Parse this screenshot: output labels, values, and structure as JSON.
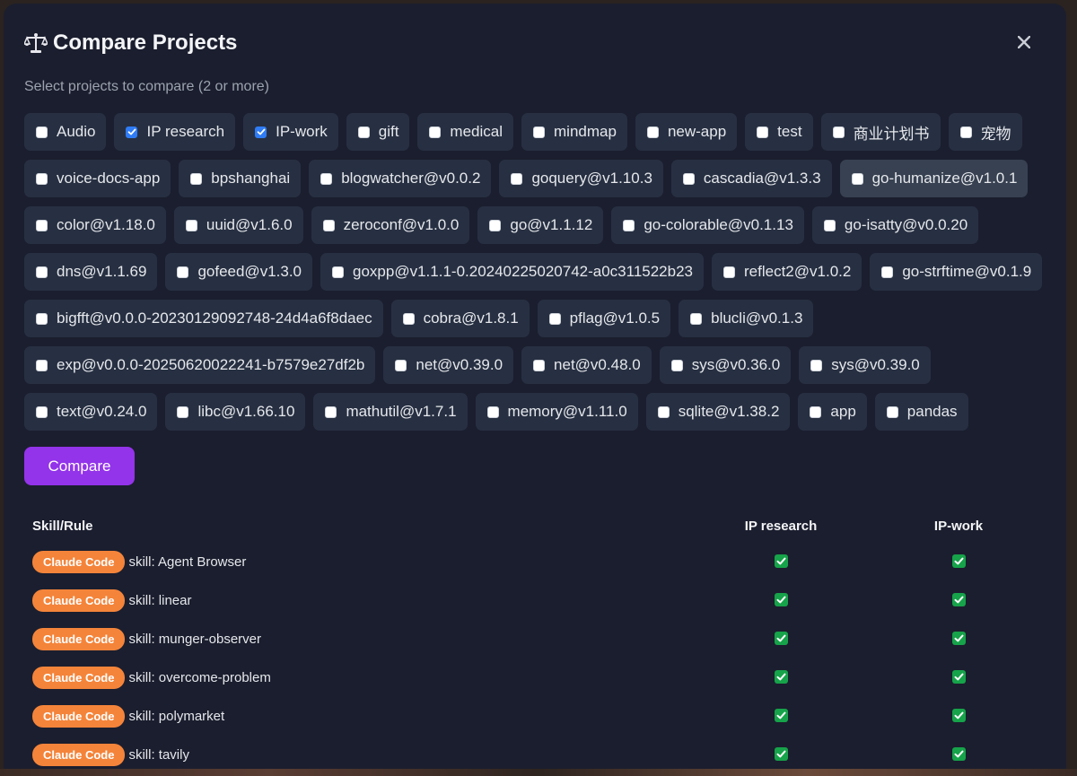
{
  "dialog": {
    "title": "Compare Projects",
    "title_icon": "scales-icon",
    "subtitle": "Select projects to compare (2 or more)",
    "close_icon": "close-icon",
    "compare_label": "Compare"
  },
  "projects": [
    {
      "label": "Audio",
      "checked": false
    },
    {
      "label": "IP research",
      "checked": true
    },
    {
      "label": "IP-work",
      "checked": true
    },
    {
      "label": "gift",
      "checked": false
    },
    {
      "label": "medical",
      "checked": false
    },
    {
      "label": "mindmap",
      "checked": false
    },
    {
      "label": "new-app",
      "checked": false
    },
    {
      "label": "test",
      "checked": false
    },
    {
      "label": "商业计划书",
      "checked": false
    },
    {
      "label": "宠物",
      "checked": false
    },
    {
      "label": "voice-docs-app",
      "checked": false
    },
    {
      "label": "bpshanghai",
      "checked": false
    },
    {
      "label": "blogwatcher@v0.0.2",
      "checked": false
    },
    {
      "label": "goquery@v1.10.3",
      "checked": false
    },
    {
      "label": "cascadia@v1.3.3",
      "checked": false
    },
    {
      "label": "go-humanize@v1.0.1",
      "checked": false,
      "hover": true
    },
    {
      "label": "color@v1.18.0",
      "checked": false
    },
    {
      "label": "uuid@v1.6.0",
      "checked": false
    },
    {
      "label": "zeroconf@v1.0.0",
      "checked": false
    },
    {
      "label": "go@v1.1.12",
      "checked": false
    },
    {
      "label": "go-colorable@v0.1.13",
      "checked": false
    },
    {
      "label": "go-isatty@v0.0.20",
      "checked": false
    },
    {
      "label": "dns@v1.1.69",
      "checked": false
    },
    {
      "label": "gofeed@v1.3.0",
      "checked": false
    },
    {
      "label": "goxpp@v1.1.1-0.20240225020742-a0c311522b23",
      "checked": false
    },
    {
      "label": "reflect2@v1.0.2",
      "checked": false
    },
    {
      "label": "go-strftime@v0.1.9",
      "checked": false
    },
    {
      "label": "bigfft@v0.0.0-20230129092748-24d4a6f8daec",
      "checked": false
    },
    {
      "label": "cobra@v1.8.1",
      "checked": false
    },
    {
      "label": "pflag@v1.0.5",
      "checked": false
    },
    {
      "label": "blucli@v0.1.3",
      "checked": false
    },
    {
      "label": "exp@v0.0.0-20250620022241-b7579e27df2b",
      "checked": false
    },
    {
      "label": "net@v0.39.0",
      "checked": false
    },
    {
      "label": "net@v0.48.0",
      "checked": false
    },
    {
      "label": "sys@v0.36.0",
      "checked": false
    },
    {
      "label": "sys@v0.39.0",
      "checked": false
    },
    {
      "label": "text@v0.24.0",
      "checked": false
    },
    {
      "label": "libc@v1.66.10",
      "checked": false
    },
    {
      "label": "mathutil@v1.7.1",
      "checked": false
    },
    {
      "label": "memory@v1.11.0",
      "checked": false
    },
    {
      "label": "sqlite@v1.38.2",
      "checked": false
    },
    {
      "label": "app",
      "checked": false
    },
    {
      "label": "pandas",
      "checked": false
    }
  ],
  "results": {
    "columns": [
      "Skill/Rule",
      "IP research",
      "IP-work"
    ],
    "rows": [
      {
        "badge": "Claude Code",
        "name": "skill: Agent Browser",
        "values": [
          true,
          true
        ]
      },
      {
        "badge": "Claude Code",
        "name": "skill: linear",
        "values": [
          true,
          true
        ]
      },
      {
        "badge": "Claude Code",
        "name": "skill: munger-observer",
        "values": [
          true,
          true
        ]
      },
      {
        "badge": "Claude Code",
        "name": "skill: overcome-problem",
        "values": [
          true,
          true
        ]
      },
      {
        "badge": "Claude Code",
        "name": "skill: polymarket",
        "values": [
          true,
          true
        ]
      },
      {
        "badge": "Claude Code",
        "name": "skill: tavily",
        "values": [
          true,
          true
        ]
      }
    ]
  },
  "colors": {
    "modal_bg": "#1b1e2e",
    "chip_bg": "#273042",
    "accent_purple": "#9333ea",
    "badge_orange": "#f4843a",
    "check_green": "#16a34a",
    "checkbox_blue": "#2f7cf6"
  }
}
